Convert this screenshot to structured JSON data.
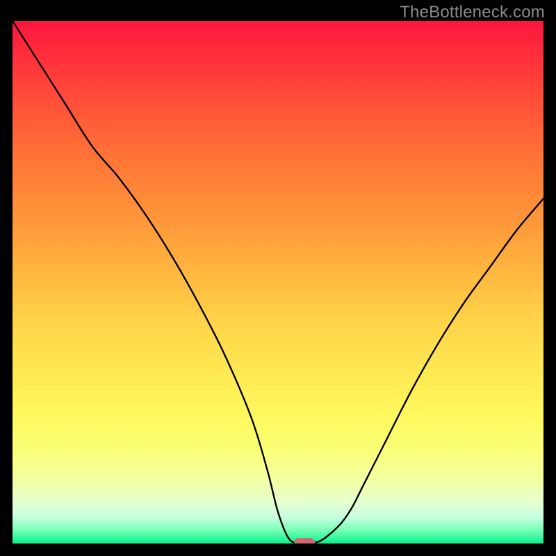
{
  "watermark": "TheBottleneck.com",
  "colors": {
    "frame_bg": "#000000",
    "curve": "#000000",
    "marker": "#cf6a6f",
    "gradient_top": "#ff153e",
    "gradient_bottom": "#08f18b"
  },
  "chart_data": {
    "type": "line",
    "title": "",
    "xlabel": "",
    "ylabel": "",
    "xlim": [
      0,
      100
    ],
    "ylim": [
      0,
      100
    ],
    "x": [
      0,
      5,
      10,
      15,
      20,
      25,
      30,
      35,
      40,
      45,
      48,
      50,
      52,
      54,
      56,
      58,
      60,
      62,
      64,
      66,
      70,
      75,
      80,
      85,
      90,
      95,
      100
    ],
    "values": [
      100,
      92,
      84,
      76,
      70,
      63,
      55,
      46,
      36,
      24,
      14,
      6,
      1,
      0,
      0,
      0.5,
      2,
      4,
      7,
      11,
      19,
      29,
      38,
      46,
      53,
      60,
      66
    ],
    "marker": {
      "x": 55,
      "y": 0
    },
    "grid": false,
    "legend": false
  }
}
